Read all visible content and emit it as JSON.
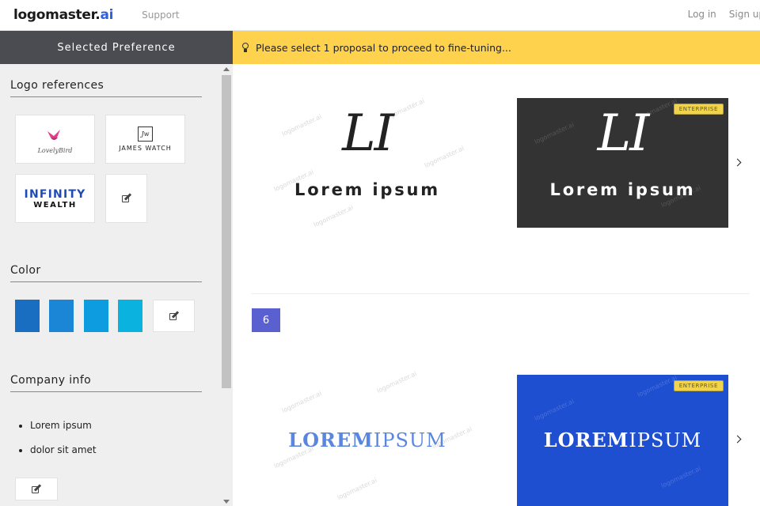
{
  "header": {
    "brand_main": "logomaster.",
    "brand_suffix": "ai",
    "support": "Support",
    "login": "Log in",
    "signup": "Sign up"
  },
  "sidebar": {
    "title": "Selected Preference",
    "logo_refs_title": "Logo references",
    "references": [
      {
        "label": "LovelyBird"
      },
      {
        "label": "JAMES WATCH",
        "monogram": "Jw"
      },
      {
        "label_top": "INFINITY",
        "label_bottom": "WEALTH"
      }
    ],
    "color_title": "Color",
    "colors": [
      "#1a6ec2",
      "#1c86d6",
      "#0e9ce0",
      "#0ab3df"
    ],
    "company_title": "Company info",
    "company_items": [
      "Lorem ipsum",
      "dolor sit amet"
    ]
  },
  "banner": {
    "text": "Please select 1 proposal to proceed to fine-tuning...",
    "color": "#ffd24e"
  },
  "proposals": {
    "first": {
      "monogram": "LI",
      "wordmark": "Lorem ipsum",
      "badge": "ENTERPRISE"
    },
    "page_number": "6",
    "second": {
      "word_bold": "LOREM",
      "word_light": "IPSUM",
      "badge": "ENTERPRISE"
    },
    "watermark": "logomaster.ai"
  }
}
